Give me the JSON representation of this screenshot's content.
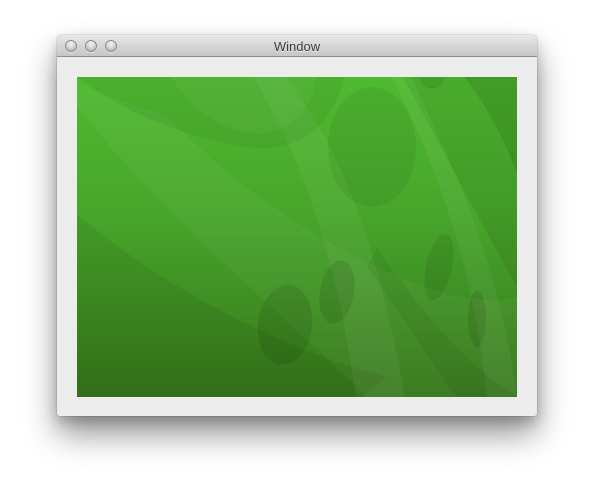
{
  "window": {
    "title": "Window"
  },
  "controls": {
    "close": "close-button",
    "minimize": "minimize-button",
    "zoom": "zoom-button"
  },
  "content": {
    "image_description_icon": "green-abstract-wallpaper"
  },
  "colors": {
    "window_bg": "#ececec",
    "wallpaper_top": "#4cb52f",
    "wallpaper_bottom": "#347412"
  }
}
